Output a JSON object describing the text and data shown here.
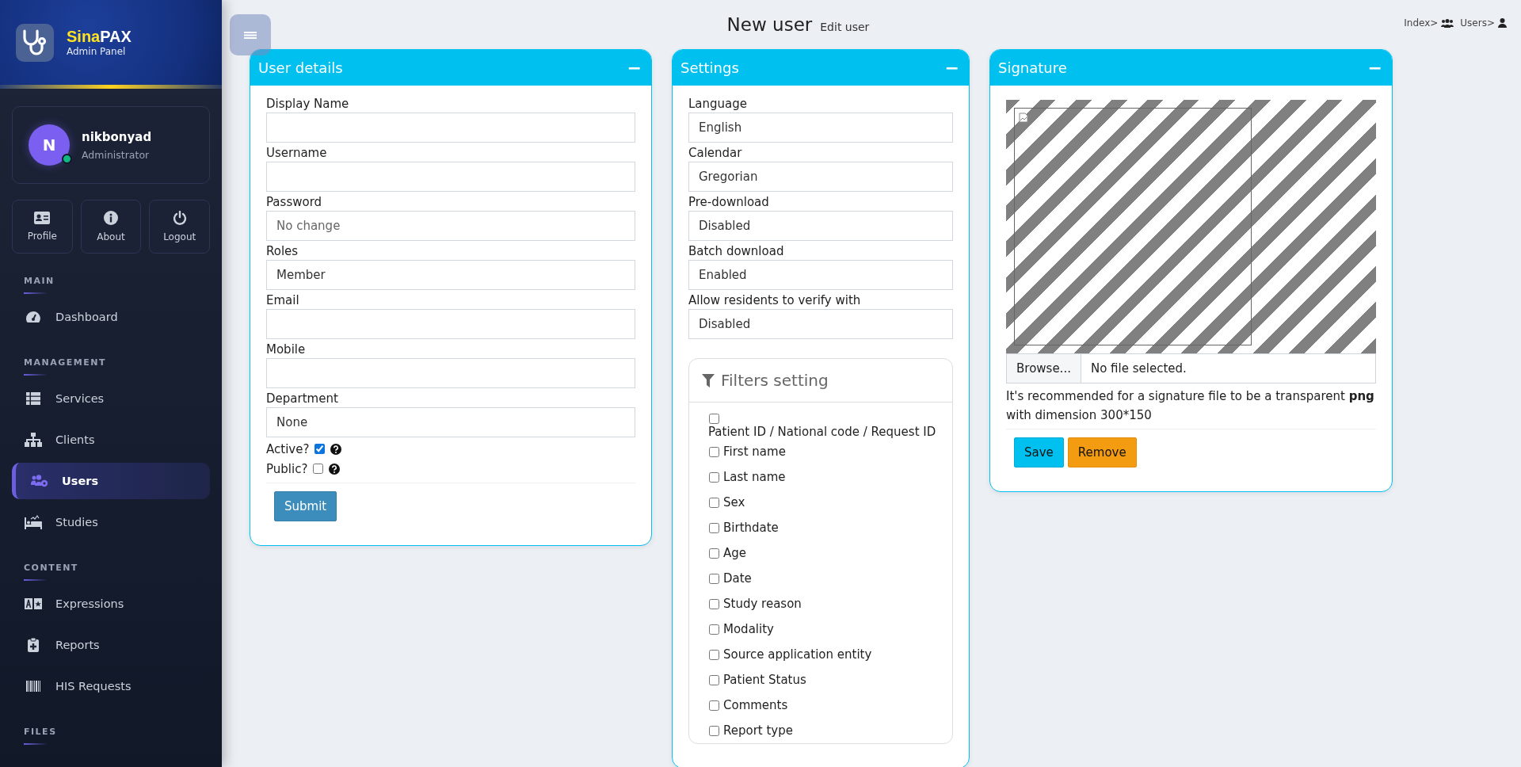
{
  "brand": {
    "highlight": "Sina",
    "rest": "PAX",
    "subtitle": "Admin Panel"
  },
  "user": {
    "initial": "N",
    "name": "nikbonyad",
    "role": "Administrator",
    "online": true
  },
  "quick_buttons": [
    {
      "label": "Profile",
      "kind": "id-card"
    },
    {
      "label": "About",
      "kind": "info"
    },
    {
      "label": "Logout",
      "kind": "power"
    }
  ],
  "nav": [
    {
      "title": "MAIN",
      "items": [
        {
          "label": "Dashboard",
          "kind": "gauge",
          "selected": false
        }
      ]
    },
    {
      "title": "MANAGEMENT",
      "items": [
        {
          "label": "Services",
          "kind": "table",
          "selected": false
        },
        {
          "label": "Clients",
          "kind": "sitemap",
          "selected": false
        },
        {
          "label": "Users",
          "kind": "users-gear",
          "selected": true
        },
        {
          "label": "Studies",
          "kind": "bed",
          "selected": false
        }
      ]
    },
    {
      "title": "CONTENT",
      "items": [
        {
          "label": "Expressions",
          "kind": "language",
          "selected": false
        },
        {
          "label": "Reports",
          "kind": "clipboard",
          "selected": false
        },
        {
          "label": "HIS Requests",
          "kind": "barcode",
          "selected": false
        }
      ]
    },
    {
      "title": "FILES"
    }
  ],
  "header": {
    "title": "New user",
    "subtitle": "Edit user",
    "breadcrumbs": [
      {
        "label": "Index>",
        "kind": "users"
      },
      {
        "label": "Users>",
        "kind": "user"
      }
    ]
  },
  "user_details": {
    "title": "User details",
    "collapse": "−",
    "fields": [
      {
        "label": "Display Name",
        "kind": "text"
      },
      {
        "label": "Username",
        "kind": "text"
      },
      {
        "label": "Password",
        "kind": "text",
        "placeholder": "No change"
      },
      {
        "label": "Roles",
        "kind": "select",
        "value": "Member"
      },
      {
        "label": "Email",
        "kind": "text"
      },
      {
        "label": "Mobile",
        "kind": "text"
      },
      {
        "label": "Department",
        "kind": "select",
        "value": "None"
      }
    ],
    "checks": [
      {
        "label": "Active?",
        "checked": true
      },
      {
        "label": "Public?",
        "checked": false
      }
    ],
    "submit": "Submit"
  },
  "settings": {
    "title": "Settings",
    "collapse": "−",
    "fields": [
      {
        "label": "Language",
        "value": "English"
      },
      {
        "label": "Calendar",
        "value": "Gregorian"
      },
      {
        "label": "Pre-download",
        "value": "Disabled"
      },
      {
        "label": "Batch download",
        "value": "Enabled"
      },
      {
        "label": "Allow residents to verify with",
        "value": "Disabled"
      }
    ],
    "filters": {
      "title": "Filters setting",
      "items": [
        {
          "label": "Patient ID / National code / Request ID",
          "checked": false
        },
        {
          "label": "First name",
          "checked": false
        },
        {
          "label": "Last name",
          "checked": false
        },
        {
          "label": "Sex",
          "checked": false
        },
        {
          "label": "Birthdate",
          "checked": false
        },
        {
          "label": "Age",
          "checked": false
        },
        {
          "label": "Date",
          "checked": false
        },
        {
          "label": "Study reason",
          "checked": false
        },
        {
          "label": "Modality",
          "checked": false
        },
        {
          "label": "Source application entity",
          "checked": false
        },
        {
          "label": "Patient Status",
          "checked": false
        },
        {
          "label": "Comments",
          "checked": false
        },
        {
          "label": "Report type",
          "checked": false
        }
      ]
    }
  },
  "signature": {
    "title": "Signature",
    "collapse": "−",
    "browse": "Browse...",
    "file_status": "No file selected.",
    "note": "It's recommended for a signature file to be a transparent **png** with dimension 300*150",
    "buttons": [
      {
        "label": "Save",
        "kind": "primary"
      },
      {
        "label": "Remove",
        "kind": "warning"
      }
    ]
  }
}
